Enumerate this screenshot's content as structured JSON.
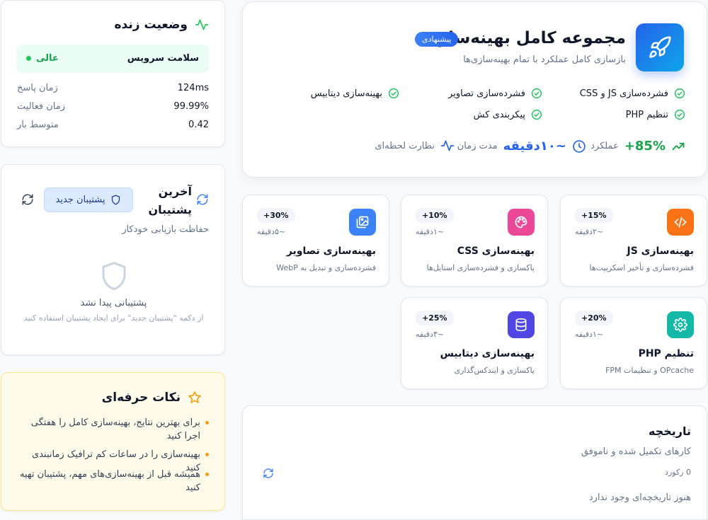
{
  "hero": {
    "title": "مجموعه کامل بهینه‌سازی",
    "badge": "پیشنهادی",
    "subtitle": "بازسازی کامل عملکرد با تمام بهینه‌سازی‌ها",
    "features": [
      "فشرده‌سازی JS و CSS",
      "فشرده‌سازی تصاویر",
      "بهینه‌سازی دیتابیس",
      "تنظیم PHP",
      "پیکربندی کش"
    ],
    "performance_value": "+85%",
    "performance_label": "عملکرد",
    "duration_value": "~۱۰دقیقه",
    "duration_label": "مدت زمان",
    "monitor_label": "نظارت لحظه‌ای"
  },
  "live_status": {
    "title": "وضعیت زنده",
    "health_label": "سلامت سرویس",
    "health_value": "عالی",
    "rows": [
      {
        "label": "زمان پاسخ",
        "value": "124ms"
      },
      {
        "label": "زمان فعالیت",
        "value": "99.99%"
      },
      {
        "label": "متوسط بار",
        "value": "0.42"
      }
    ]
  },
  "backup": {
    "title_line1": "آخرین",
    "title_line2": "پشتیبان",
    "new_button": "پشتیبان جدید",
    "subtitle": "حفاظت بازیابی خودکار",
    "empty_title": "پشتیبانی پیدا نشد",
    "empty_hint": "از دکمه \"پشتیبان جدید\" برای ایجاد پشتیبان استفاده کنید"
  },
  "tips": {
    "title": "نکات حرفه‌ای",
    "items": [
      "برای بهترین نتایج، بهینه‌سازی کامل را هفتگی اجرا کنید",
      "بهینه‌سازی را در ساعات کم ترافیک زمانبندی کنید",
      "همیشه قبل از بهینه‌سازی‌های مهم، پشتیبان تهیه کنید"
    ]
  },
  "optimizations": [
    {
      "title": "بهینه‌سازی JS",
      "desc": "فشرده‌سازی و تأخیر اسکریپت‌ها",
      "badge": "+15%",
      "time": "~۲دقیقه",
      "icon": "code-icon",
      "color": "#f97316"
    },
    {
      "title": "بهینه‌سازی CSS",
      "desc": "پاکسازی و فشرده‌سازی استایل‌ها",
      "badge": "+10%",
      "time": "~۱دقیقه",
      "icon": "palette-icon",
      "color": "#ec4899"
    },
    {
      "title": "بهینه‌سازی تصاویر",
      "desc": "فشرده‌سازی و تبدیل به WebP",
      "badge": "+30%",
      "time": "~۵دقیقه",
      "icon": "images-icon",
      "color": "#3b82f6"
    },
    {
      "title": "تنظیم PHP",
      "desc": "OPcache و تنظیمات FPM",
      "badge": "+20%",
      "time": "~۱دقیقه",
      "icon": "gear-icon",
      "color": "#14b8a6"
    },
    {
      "title": "بهینه‌سازی دیتابیس",
      "desc": "پاکسازی و ایندکس‌گذاری",
      "badge": "+25%",
      "time": "~۳دقیقه",
      "icon": "database-icon",
      "color": "#4f46e5"
    }
  ],
  "history": {
    "title": "تاریخچه",
    "subtitle": "کارهای تکمیل شده و ناموفق",
    "count": "0 رکورد",
    "empty": "هنوز تاریخچه‌ای وجود ندارد"
  }
}
